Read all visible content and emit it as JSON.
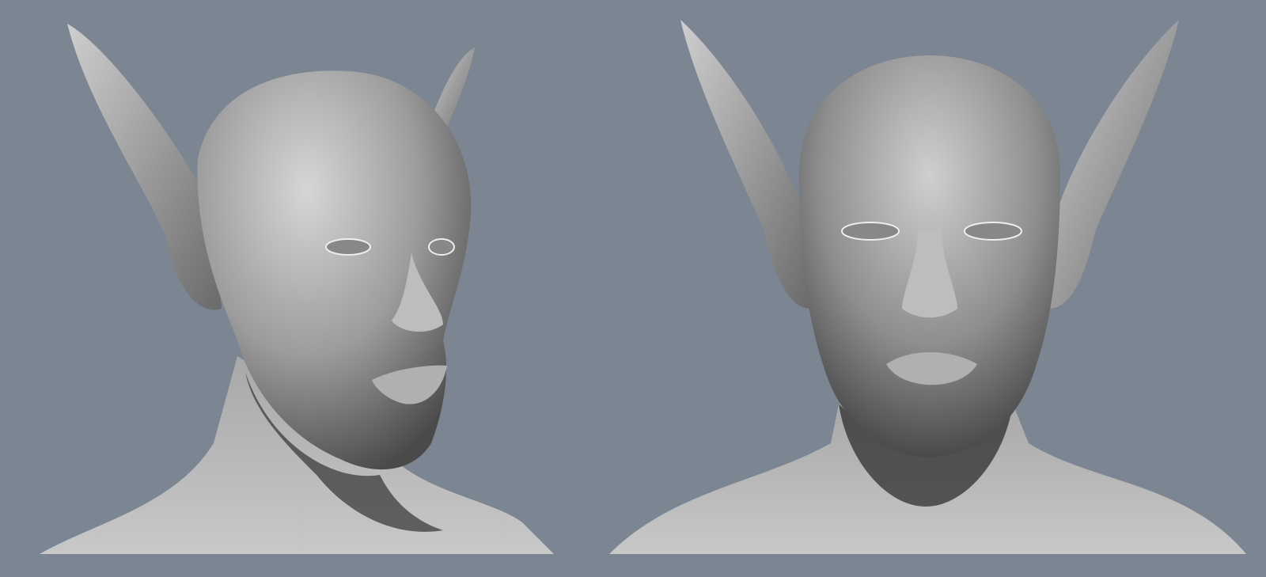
{
  "scene": {
    "background_color": "#7b8692",
    "skin_light": "#d2d2d2",
    "skin_mid": "#9a9a9a",
    "skin_dark": "#3a3a3a",
    "views": [
      "three-quarter",
      "front"
    ]
  }
}
